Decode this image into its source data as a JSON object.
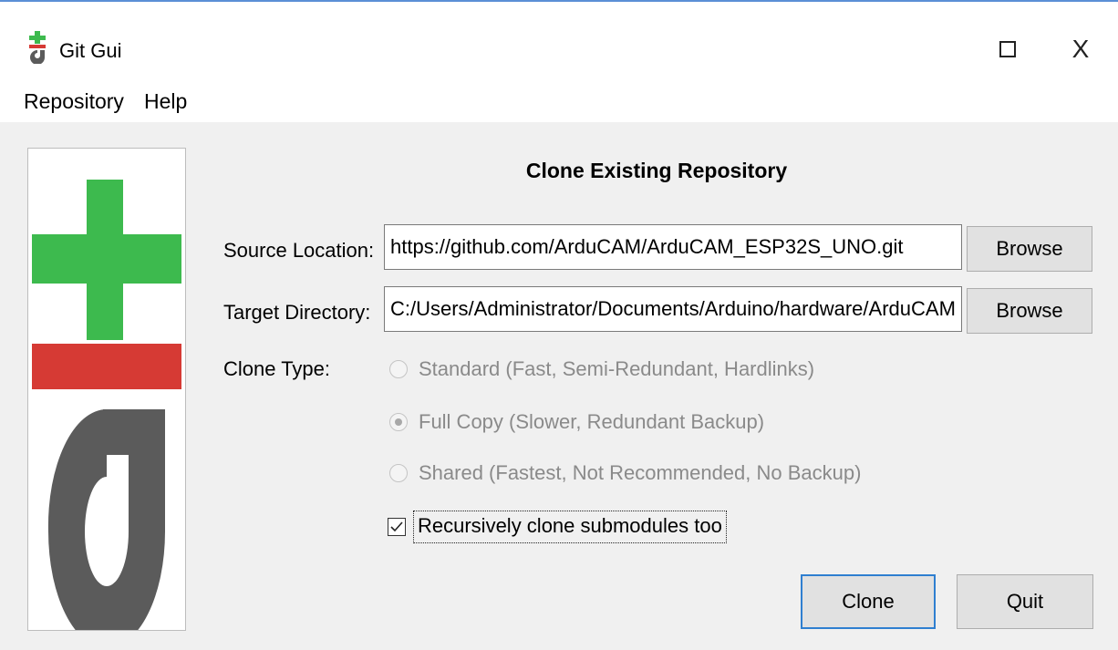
{
  "window": {
    "title": "Git Gui",
    "icons": {
      "app": "git-gui-icon",
      "maximize": "maximize-icon",
      "close": "close-icon"
    },
    "close_glyph": "X"
  },
  "menu": {
    "items": [
      {
        "label": "Repository"
      },
      {
        "label": "Help"
      }
    ]
  },
  "dialog": {
    "heading": "Clone Existing Repository",
    "source_location": {
      "label": "Source Location:",
      "value": "https://github.com/ArduCAM/ArduCAM_ESP32S_UNO.git",
      "browse_label": "Browse"
    },
    "target_directory": {
      "label": "Target Directory:",
      "value": "C:/Users/Administrator/Documents/Arduino/hardware/ArduCAM",
      "browse_label": "Browse"
    },
    "clone_type": {
      "label": "Clone Type:",
      "selected": "Full Copy (Slower, Redundant Backup)",
      "options": [
        {
          "label": "Standard (Fast, Semi-Redundant, Hardlinks)",
          "checked": false,
          "disabled": true
        },
        {
          "label": "Full Copy (Slower, Redundant Backup)",
          "checked": true,
          "disabled": true
        },
        {
          "label": "Shared (Fastest, Not Recommended, No Backup)",
          "checked": false,
          "disabled": true
        }
      ]
    },
    "recursive": {
      "label": "Recursively clone submodules too",
      "checked": true
    },
    "buttons": {
      "clone": "Clone",
      "quit": "Quit"
    }
  },
  "colors": {
    "logo_green": "#3dba4e",
    "logo_red": "#d63a34",
    "logo_gray": "#5b5b5b",
    "focus_blue": "#2f7fd0",
    "title_accent": "#5b8fd6"
  }
}
